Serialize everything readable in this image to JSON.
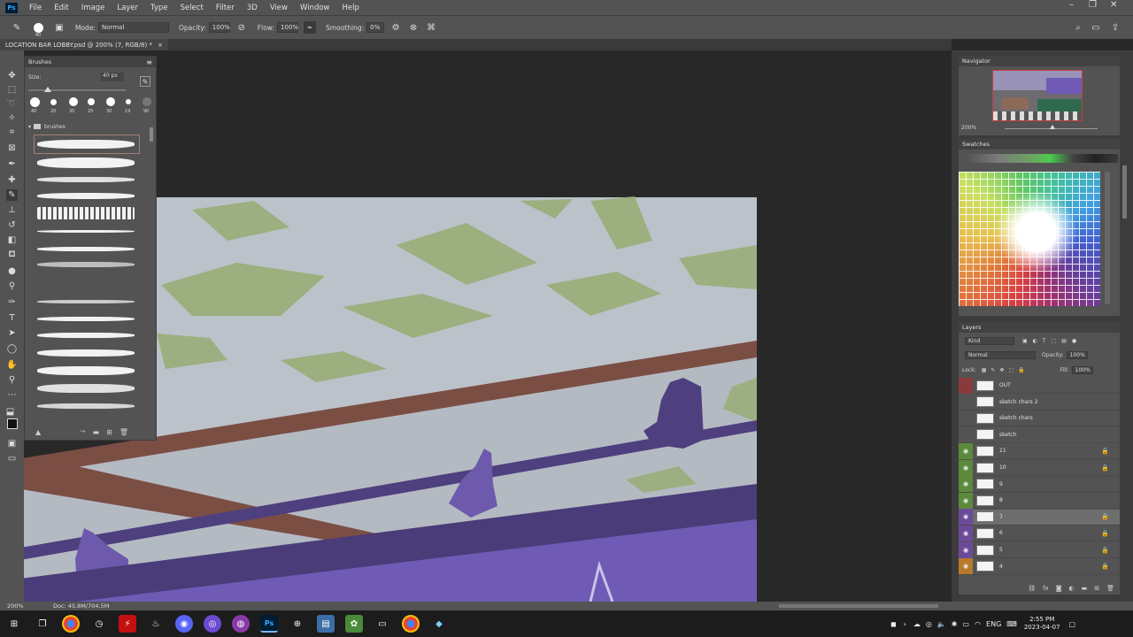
{
  "menubar": {
    "logo": "Ps",
    "items": [
      "File",
      "Edit",
      "Image",
      "Layer",
      "Type",
      "Select",
      "Filter",
      "3D",
      "View",
      "Window",
      "Help"
    ]
  },
  "options": {
    "brush_size": "40",
    "mode_label": "Mode:",
    "mode_value": "Normal",
    "opacity_label": "Opacity:",
    "opacity_value": "100%",
    "flow_label": "Flow:",
    "flow_value": "100%",
    "smoothing_label": "Smoothing:",
    "smoothing_value": "0%"
  },
  "document": {
    "tab_title": "LOCATION BAR LOBBY.psd @ 200% (7, RGB/8) *",
    "tab_close": "×"
  },
  "brushes_panel": {
    "title": "Brushes",
    "size_label": "Size:",
    "size_value": "40 px",
    "presets": [
      "40",
      "20",
      "35",
      "25",
      "30",
      "19",
      "90"
    ],
    "folder_name": "brushes"
  },
  "navigator": {
    "title": "Navigator",
    "zoom": "200%"
  },
  "swatches": {
    "title": "Swatches"
  },
  "layers_panel": {
    "title": "Layers",
    "filter_kind": "Kind",
    "blend_mode": "Normal",
    "opacity_label": "Opacity:",
    "opacity_value": "100%",
    "lock_label": "Lock:",
    "fill_label": "Fill:",
    "fill_value": "100%",
    "layers": [
      {
        "name": "OUT",
        "eye": "",
        "color": "#8a3a3a",
        "locked": false
      },
      {
        "name": "sketch chars 2",
        "eye": "",
        "color": "",
        "locked": false
      },
      {
        "name": "sketch chars",
        "eye": "",
        "color": "",
        "locked": false
      },
      {
        "name": "sketch",
        "eye": "",
        "color": "",
        "locked": false
      },
      {
        "name": "11",
        "eye": "visible",
        "color": "#5d8a3a",
        "locked": true
      },
      {
        "name": "10",
        "eye": "visible",
        "color": "#5d8a3a",
        "locked": true
      },
      {
        "name": "9",
        "eye": "visible",
        "color": "#5d8a3a",
        "locked": false
      },
      {
        "name": "8",
        "eye": "visible",
        "color": "#5d8a3a",
        "locked": false
      },
      {
        "name": "7",
        "eye": "visible",
        "color": "#6b4a9a",
        "locked": true,
        "selected": true
      },
      {
        "name": "6",
        "eye": "visible",
        "color": "#6b4a9a",
        "locked": true
      },
      {
        "name": "5",
        "eye": "visible",
        "color": "#6b4a9a",
        "locked": true
      },
      {
        "name": "4",
        "eye": "visible",
        "color": "#b87a2a",
        "locked": true
      }
    ]
  },
  "statusbar": {
    "zoom": "200%",
    "doc_info": "Doc: 45.8M/704.5M"
  },
  "taskbar": {
    "time": "2:55 PM",
    "date": "2023-04-07",
    "lang": "ENG"
  },
  "colors": {
    "accent_purple": "#6f5ab5",
    "dark_purple": "#4e3f7e",
    "rail_brown": "#7a4f42",
    "ceiling_gray": "#b8bec6",
    "money_green": "#9caf7d"
  }
}
